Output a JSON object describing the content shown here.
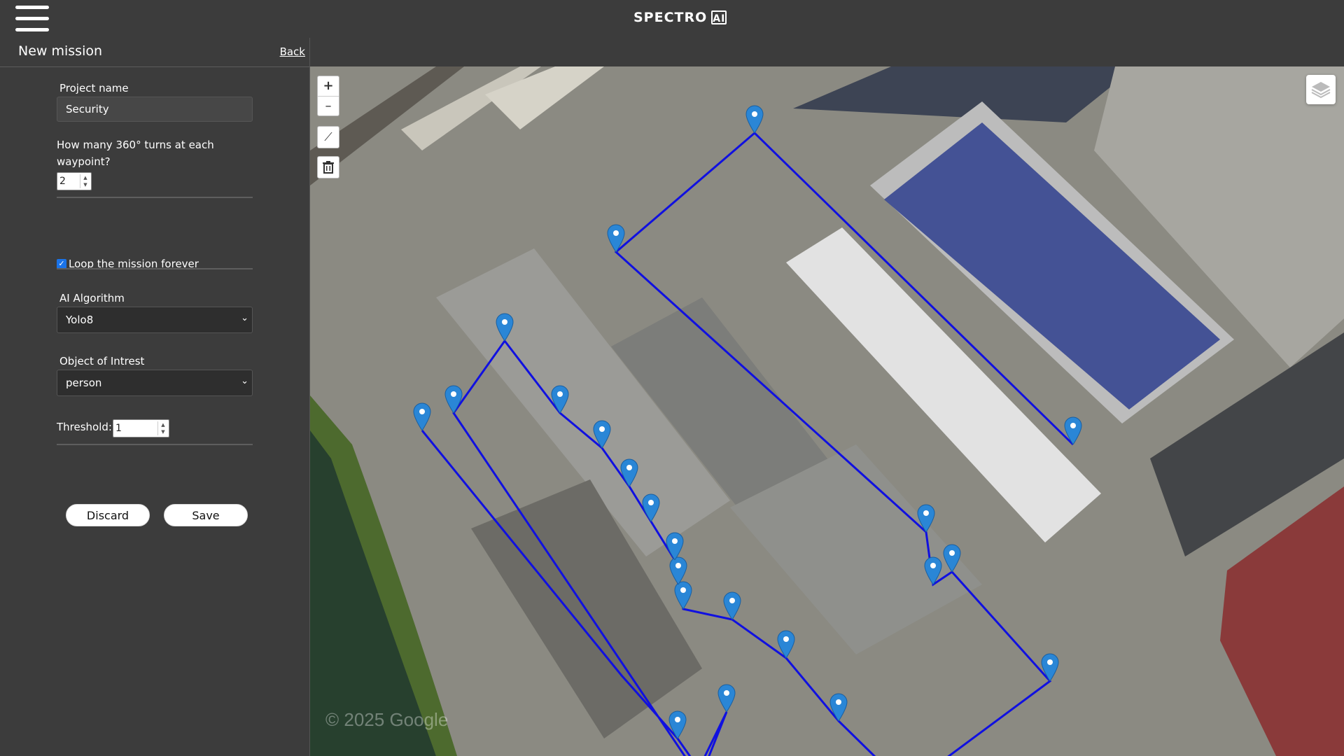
{
  "app": {
    "logo": "SPECTRO",
    "logo_badge": "AI"
  },
  "panel": {
    "title": "New mission",
    "back_label": "Back",
    "project_name_label": "Project name",
    "project_name_value": "Security",
    "turns_label_line1": "How many 360° turns at each",
    "turns_label_line2": "waypoint?",
    "turns_value": "2",
    "loop_label": "Loop the mission forever",
    "loop_checked": true,
    "algorithm_label": "AI Algorithm",
    "algorithm_value": "Yolo8",
    "object_label": "Object of Intrest",
    "object_value": "person",
    "threshold_label": "Threshold:",
    "threshold_value": "1",
    "discard_label": "Discard",
    "save_label": "Save"
  },
  "map": {
    "zoom_in": "+",
    "zoom_out": "–",
    "watermark": "© 2025 Google",
    "route_color": "#1010e0",
    "pin_color": "#2a86d6"
  }
}
